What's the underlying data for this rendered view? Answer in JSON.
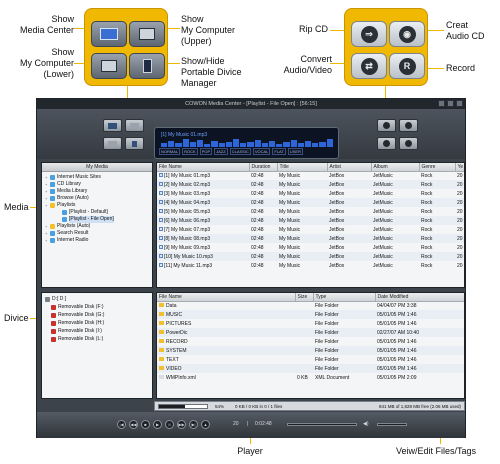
{
  "annotations": {
    "show_media_center": "Show\nMedia Center",
    "show_my_computer_lower": "Show\nMy Computer\n(Lower)",
    "show_my_computer_upper": "Show\nMy Computer\n(Upper)",
    "show_hide_portable": "Show/Hide\nPortable Divice\nManager",
    "rip_cd": "Rip CD",
    "convert_audio_video": "Convert\nAudio/Video",
    "creat_audio_cd": "Creat\nAudio CD",
    "record": "Record",
    "media": "Media",
    "divice": "Divice",
    "player": "Player",
    "view_edit": "Veiw/Edit Files/Tags"
  },
  "window": {
    "title": "COWON Media Center - [Playlist - File Open] : [56:15]"
  },
  "lcd": {
    "track_text": "[1] My Music 01.mp3",
    "eq_presets": [
      "NORMAL",
      "ROCK",
      "POP",
      "JAZZ",
      "CLASSIC",
      "VOCAL",
      "FLAT",
      "USER"
    ],
    "bar_levels": [
      0.4,
      0.7,
      0.5,
      0.9,
      0.6,
      0.8,
      0.3,
      0.7,
      0.5,
      0.6,
      0.9,
      0.4,
      0.6,
      0.8,
      0.5,
      0.7,
      0.3,
      0.6,
      0.8,
      0.4,
      0.7,
      0.5,
      0.6,
      0.9
    ]
  },
  "media_tree": {
    "header": "My Media",
    "items": [
      {
        "label": "Internet Music Sites",
        "icon": "globe-icon",
        "indent": 0
      },
      {
        "label": "CD Library",
        "icon": "cd-icon",
        "indent": 0
      },
      {
        "label": "Media Library",
        "icon": "library-icon",
        "indent": 0
      },
      {
        "label": "Browse (Auto)",
        "icon": "browse-icon",
        "indent": 0
      },
      {
        "label": "Playlists",
        "icon": "folder-icon",
        "indent": 0
      },
      {
        "label": "[Playlist - Default]",
        "icon": "playlist-icon",
        "indent": 1
      },
      {
        "label": "[Playlist - File Open]",
        "icon": "playlist-icon",
        "indent": 1
      },
      {
        "label": "Playlists (Auto)",
        "icon": "folder-icon",
        "indent": 0
      },
      {
        "label": "Search Result",
        "icon": "search-icon",
        "indent": 0
      },
      {
        "label": "Internet Radio",
        "icon": "radio-icon",
        "indent": 0
      }
    ]
  },
  "playlist_table": {
    "columns": [
      "File Name",
      "Duration",
      "Title",
      "Artist",
      "Album",
      "Genre",
      "Ye"
    ],
    "rows": [
      [
        "[1] My Music 01.mp3",
        "02:48",
        "My Music",
        "JetBox",
        "JetMusic",
        "Rock",
        "20"
      ],
      [
        "[2] My Music 02.mp3",
        "02:48",
        "My Music",
        "JetBox",
        "JetMusic",
        "Rock",
        "20"
      ],
      [
        "[3] My Music 03.mp3",
        "02:48",
        "My Music",
        "JetBox",
        "JetMusic",
        "Rock",
        "20"
      ],
      [
        "[4] My Music 04.mp3",
        "02:48",
        "My Music",
        "JetBox",
        "JetMusic",
        "Rock",
        "20"
      ],
      [
        "[5] My Music 05.mp3",
        "02:48",
        "My Music",
        "JetBox",
        "JetMusic",
        "Rock",
        "20"
      ],
      [
        "[6] My Music 06.mp3",
        "02:48",
        "My Music",
        "JetBox",
        "JetMusic",
        "Rock",
        "20"
      ],
      [
        "[7] My Music 07.mp3",
        "02:48",
        "My Music",
        "JetBox",
        "JetMusic",
        "Rock",
        "20"
      ],
      [
        "[8] My Music 08.mp3",
        "02:48",
        "My Music",
        "JetBox",
        "JetMusic",
        "Rock",
        "20"
      ],
      [
        "[9] My Music 09.mp3",
        "02:48",
        "My Music",
        "JetBox",
        "JetMusic",
        "Rock",
        "20"
      ],
      [
        "[10] My Music 10.mp3",
        "02:48",
        "My Music",
        "JetBox",
        "JetMusic",
        "Rock",
        "20"
      ],
      [
        "[11] My Music 11.mp3",
        "02:48",
        "My Music",
        "JetBox",
        "JetMusic",
        "Rock",
        "20"
      ]
    ]
  },
  "device_tree": {
    "items": [
      {
        "label": "D:[ D ]",
        "icon": "drive-icon"
      },
      {
        "label": "Removable Disk (F:)",
        "icon": "removable-disk-icon"
      },
      {
        "label": "Removable Disk (G:)",
        "icon": "removable-disk-icon"
      },
      {
        "label": "Removable Disk (H:)",
        "icon": "removable-disk-icon"
      },
      {
        "label": "Removable Disk (I:)",
        "icon": "removable-disk-icon"
      },
      {
        "label": "Removable Disk (L:)",
        "icon": "removable-disk-icon"
      }
    ]
  },
  "files_table": {
    "columns": [
      "File Name",
      "Size",
      "Type",
      "Date Modified"
    ],
    "rows": [
      [
        "Data",
        "",
        "File Folder",
        "04/04/07 PM 3:38"
      ],
      [
        "MUSIC",
        "",
        "File Folder",
        "05/01/05 PM 1:46"
      ],
      [
        "PICTURES",
        "",
        "File Folder",
        "05/01/05 PM 1:46"
      ],
      [
        "PowerDic",
        "",
        "File Folder",
        "02/27/07 AM 10:40"
      ],
      [
        "RECORD",
        "",
        "File Folder",
        "05/01/05 PM 1:46"
      ],
      [
        "SYSTEM",
        "",
        "File Folder",
        "05/01/05 PM 1:46"
      ],
      [
        "TEXT",
        "",
        "File Folder",
        "05/01/05 PM 1:46"
      ],
      [
        "VIDEO",
        "",
        "File Folder",
        "05/01/05 PM 1:46"
      ],
      [
        "WMPInfo.xml",
        "0 KB",
        "XML Document",
        "05/01/05 PM 2:09"
      ]
    ]
  },
  "status": {
    "percent": "54%",
    "progress_fraction": 0.54,
    "files_text": "0 KB / 0 KB in 0 / 1 files",
    "space_text": "841 MB of 1,828 MB free (2.06 MB used)"
  },
  "player": {
    "track_count": "20",
    "separator": "|",
    "time": "0:02:48",
    "buttons": [
      "prev-icon",
      "rewind-icon",
      "stop-icon",
      "play-icon",
      "pause-icon",
      "forward-icon",
      "next-icon",
      "eject-icon"
    ]
  }
}
